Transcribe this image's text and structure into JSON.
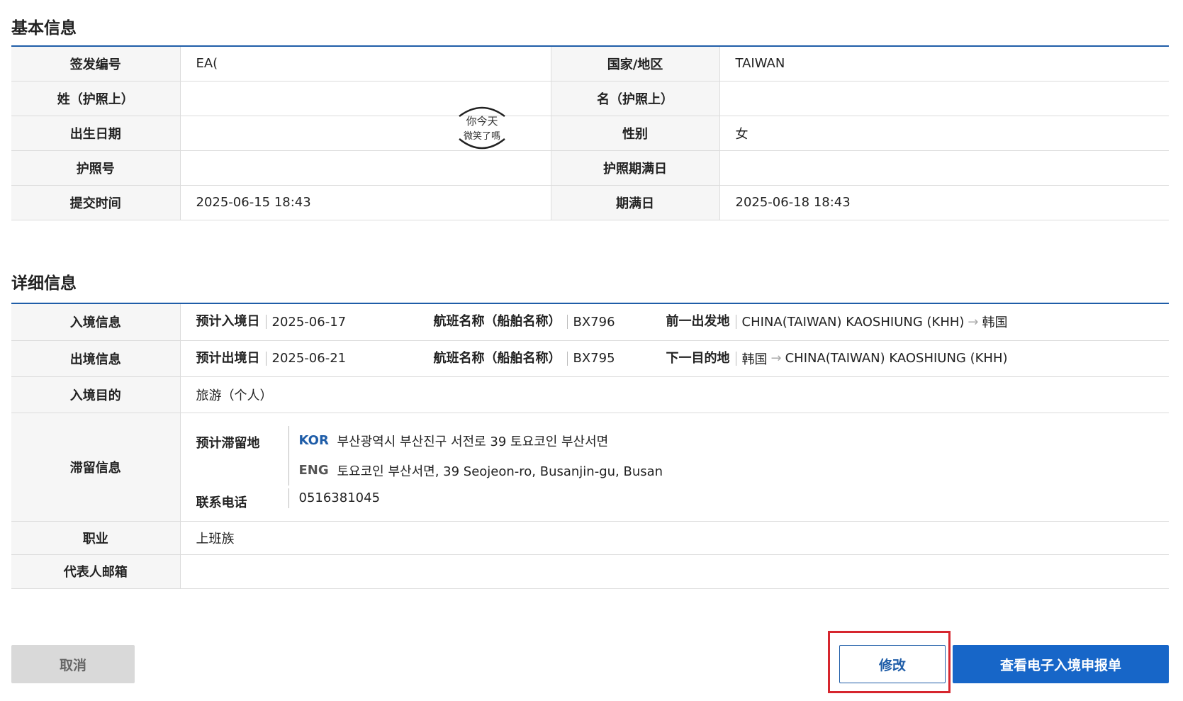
{
  "basic": {
    "title": "基本信息",
    "rows": [
      {
        "l1": "签发编号",
        "v1": "EA(",
        "l2": "国家/地区",
        "v2": "TAIWAN"
      },
      {
        "l1": "姓（护照上）",
        "v1": "",
        "l2": "名（护照上）",
        "v2": ""
      },
      {
        "l1": "出生日期",
        "v1": "",
        "l2": "性别",
        "v2": "女"
      },
      {
        "l1": "护照号",
        "v1": "",
        "l2": "护照期满日",
        "v2": ""
      },
      {
        "l1": "提交时间",
        "v1": "2025-06-15 18:43",
        "l2": "期满日",
        "v2": "2025-06-18 18:43"
      }
    ]
  },
  "watermark": {
    "line1": "你今天",
    "line2": "微笑了嗎"
  },
  "detail": {
    "title": "详细信息",
    "entry": {
      "label": "入境信息",
      "date_key": "预计入境日",
      "date_val": "2025-06-17",
      "flight_key": "航班名称（船舶名称）",
      "flight_val": "BX796",
      "route_key": "前一出发地",
      "route_from": "CHINA(TAIWAN) KAOSHIUNG (KHH)",
      "route_arrow": "→",
      "route_to": "韩国"
    },
    "exit": {
      "label": "出境信息",
      "date_key": "预计出境日",
      "date_val": "2025-06-21",
      "flight_key": "航班名称（船舶名称）",
      "flight_val": "BX795",
      "route_key": "下一目的地",
      "route_from": "韩国",
      "route_arrow": "→",
      "route_to": "CHINA(TAIWAN) KAOSHIUNG (KHH)"
    },
    "purpose": {
      "label": "入境目的",
      "value": "旅游（个人）"
    },
    "stay": {
      "label": "滞留信息",
      "place_key": "预计滞留地",
      "kor_tag": "KOR",
      "kor_addr": "부산광역시 부산진구 서전로 39 토요코인 부산서면",
      "eng_tag": "ENG",
      "eng_addr": "토요코인 부산서면, 39 Seojeon-ro, Busanjin-gu, Busan",
      "phone_key": "联系电话",
      "phone_val": "0516381045"
    },
    "job": {
      "label": "职业",
      "value": "上班族"
    },
    "email": {
      "label": "代表人邮箱",
      "value": ""
    }
  },
  "buttons": {
    "cancel": "取消",
    "modify": "修改",
    "view": "查看电子入境申报单"
  },
  "colors": {
    "accent": "#1766c8",
    "highlight": "#d6262e"
  }
}
